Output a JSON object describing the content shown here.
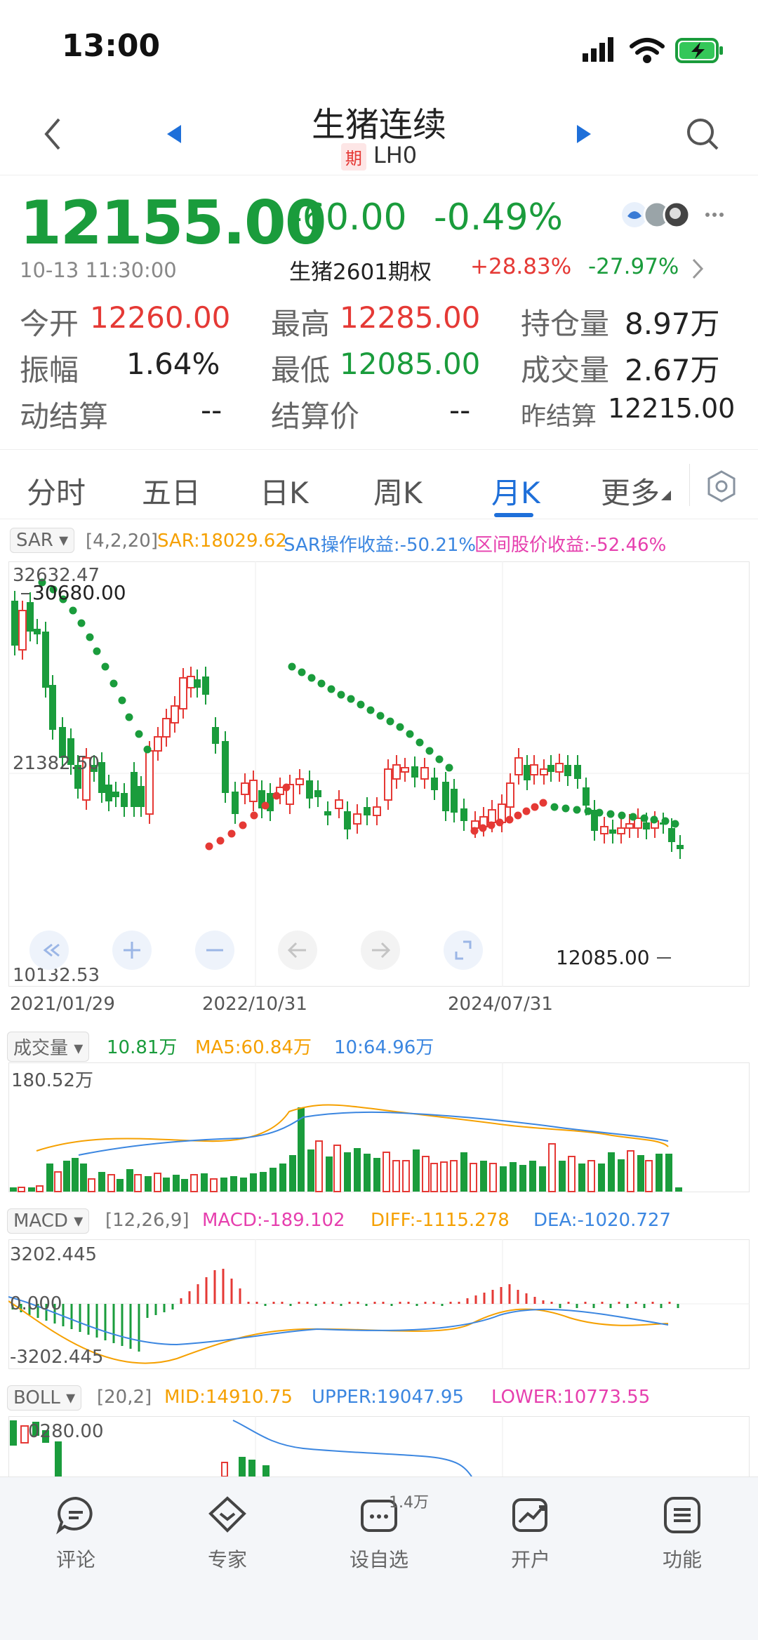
{
  "status": {
    "time": "13:00"
  },
  "nav": {
    "title": "生猪连续",
    "badge": "期",
    "code": "LH0"
  },
  "quote": {
    "price": "12155.00",
    "change": "-60.00",
    "change_pct": "-0.49%",
    "datetime": "10-13 11:30:00",
    "option_name": "生猪2601期权",
    "option_up": "+28.83%",
    "option_down": "-27.97%"
  },
  "stats": {
    "open_label": "今开",
    "open": "12260.00",
    "high_label": "最高",
    "high": "12285.00",
    "oi_label": "持仓量",
    "oi": "8.97万",
    "amp_label": "振幅",
    "amp": "1.64%",
    "low_label": "最低",
    "low": "12085.00",
    "vol_label": "成交量",
    "vol": "2.67万",
    "dyn_label": "动结算",
    "dyn": "--",
    "settle_label": "结算价",
    "settle": "--",
    "prev_label": "昨结算",
    "prev": "12215.00"
  },
  "tabs": [
    "分时",
    "五日",
    "日K",
    "周K",
    "月K",
    "更多"
  ],
  "sar": {
    "name": "SAR",
    "params": "[4,2,20]",
    "value": "SAR:18029.62",
    "op_return": "SAR操作收益:-50.21%",
    "range_return": "区间股价收益:-52.46%",
    "y_top": "32632.47",
    "y_mid": "21382.50",
    "y_bot": "10132.53",
    "hi_mark": "30680.00",
    "lo_mark": "12085.00",
    "x_labels": [
      "2021/01/29",
      "2022/10/31",
      "2024/07/31"
    ]
  },
  "volume": {
    "name": "成交量",
    "cur": "10.81万",
    "ma5": "MA5:60.84万",
    "ma10": "10:64.96万",
    "y_top": "180.52万"
  },
  "macd": {
    "name": "MACD",
    "params": "[12,26,9]",
    "macd": "MACD:-189.102",
    "diff": "DIFF:-1115.278",
    "dea": "DEA:-1020.727",
    "y_top": "3202.445",
    "y_mid": "0.000",
    "y_bot": "-3202.445"
  },
  "boll": {
    "name": "BOLL",
    "params": "[20,2]",
    "mid": "MID:14910.75",
    "upper": "UPPER:19047.95",
    "lower": "LOWER:10773.55",
    "y_top": "0280.00"
  },
  "bottom": {
    "comment": "评论",
    "expert": "专家",
    "watch": "设自选",
    "watch_badge": "1.4万",
    "account": "开户",
    "func": "功能"
  },
  "colors": {
    "up": "#e53935",
    "down": "#1a9c3c",
    "accent": "#1e6fd9",
    "sar_dot_up": "#e53935",
    "sar_dot_down": "#1a9c3c"
  }
}
